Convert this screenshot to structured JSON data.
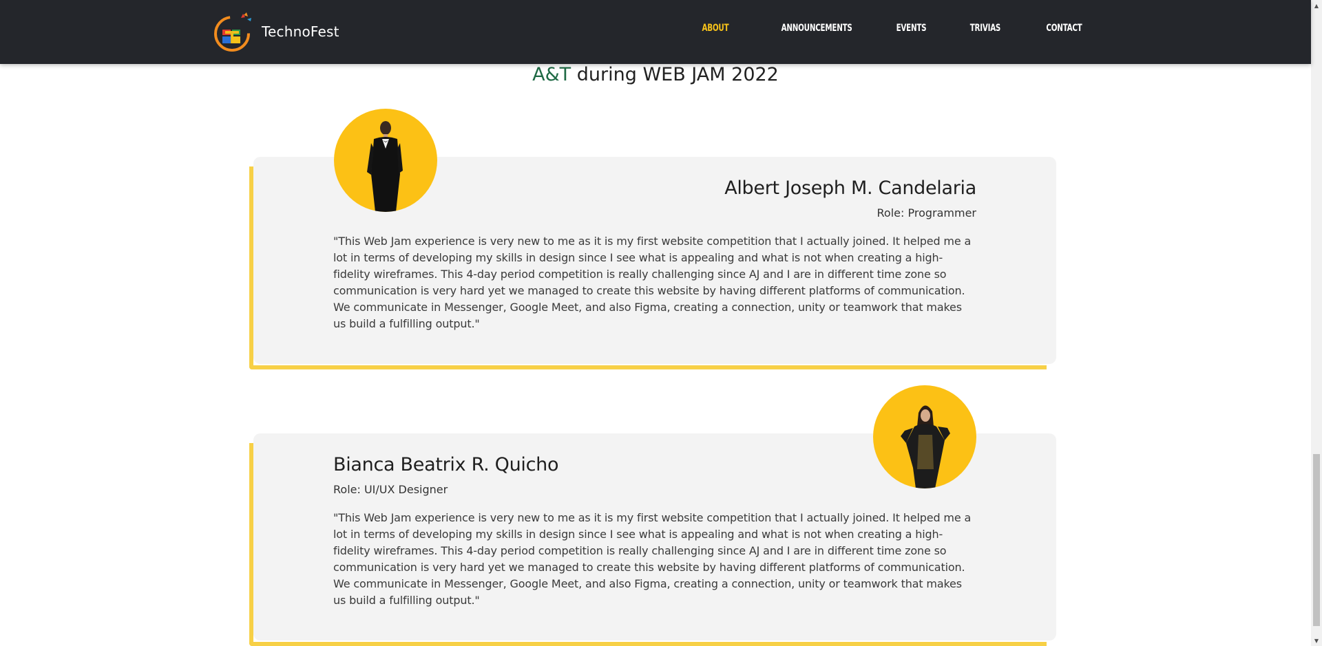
{
  "header": {
    "brand": "TechnoFest",
    "nav": [
      {
        "label": "ABOUT",
        "active": true
      },
      {
        "label": "ANNOUNCEMENTS",
        "active": false
      },
      {
        "label": "EVENTS",
        "active": false
      },
      {
        "label": "TRIVIAS",
        "active": false
      },
      {
        "label": "CONTACT",
        "active": false
      }
    ]
  },
  "section": {
    "title_accent": "A&T",
    "title_rest": " during WEB JAM 2022"
  },
  "members": [
    {
      "name": "Albert Joseph M. Candelaria",
      "role": "Role: Programmer",
      "quote": "\"This Web Jam experience is very new to me as it is my first website competition that I actually joined. It helped me a lot in terms of developing my skills in design since I see what is appealing and what is not when creating a high-fidelity wireframes. This 4-day period competition is really challenging since AJ and I are in different time zone so communication is very hard yet we managed to create this website by having different platforms of communication. We communicate in Messenger, Google Meet, and also Figma, creating a connection, unity or teamwork that makes us build a fulfilling output.\""
    },
    {
      "name": "Bianca Beatrix R. Quicho",
      "role": "Role: UI/UX Designer",
      "quote": "\"This Web Jam experience is very new to me as it is my first website competition that I actually joined. It helped me a lot in terms of developing my skills in design since I see what is appealing and what is not when creating a high-fidelity wireframes. This 4-day period competition is really challenging since AJ and I are in different time zone so communication is very hard yet we managed to create this website by having different platforms of communication. We communicate in Messenger, Google Meet, and also Figma, creating a connection, unity or teamwork that makes us build a fulfilling output.\""
    }
  ],
  "colors": {
    "header_bg": "#24262b",
    "accent_yellow": "#f7c21a",
    "title_green": "#1f6a45",
    "card_bg": "#f3f3f3",
    "card_border": "#f7d046",
    "avatar_bg": "#fcc115"
  }
}
